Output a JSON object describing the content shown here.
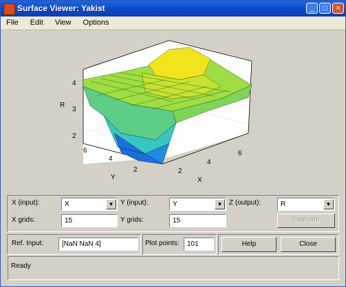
{
  "window": {
    "title": "Surface Viewer: Yakist"
  },
  "menu": [
    "File",
    "Edit",
    "View",
    "Options"
  ],
  "plot": {
    "z_axis_label": "R",
    "y_axis_label": "Y",
    "x_axis_label": "X",
    "z_ticks": [
      "2",
      "3",
      "4"
    ],
    "y_ticks": [
      "2",
      "4",
      "6"
    ],
    "x_ticks": [
      "2",
      "4",
      "6"
    ]
  },
  "controls": {
    "x_input_label": "X (input):",
    "x_input_value": "X",
    "y_input_label": "Y (input):",
    "y_input_value": "Y",
    "z_output_label": "Z (output):",
    "z_output_value": "R",
    "x_grids_label": "X grids:",
    "x_grids_value": "15",
    "y_grids_label": "Y grids:",
    "y_grids_value": "15",
    "evaluate_label": "Evaluate"
  },
  "bottom": {
    "ref_input_label": "Ref. Input:",
    "ref_input_value": "[NaN NaN 4]",
    "plot_points_label": "Plot points:",
    "plot_points_value": "101",
    "help_label": "Help",
    "close_label": "Close"
  },
  "status": {
    "text": "Ready"
  },
  "colors": {
    "titlebar": "#0a48c8",
    "surface_high": "#f2e51e",
    "surface_mid": "#8fd84a",
    "surface_low": "#1a4fd8"
  }
}
